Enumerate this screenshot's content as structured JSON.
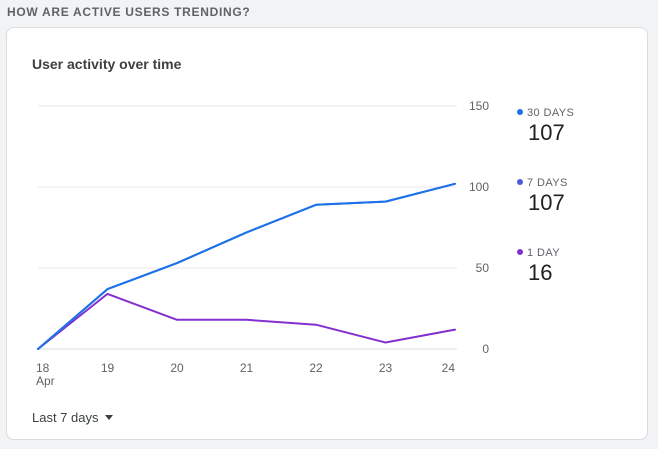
{
  "section_title": "HOW ARE ACTIVE USERS TRENDING?",
  "card": {
    "title": "User activity over time",
    "period_label": "Last 7 days",
    "period_icon": "dropdown-caret-icon"
  },
  "legend": [
    {
      "label": "30 DAYS",
      "value": "107",
      "color": "#1a73e8"
    },
    {
      "label": "7 DAYS",
      "value": "107",
      "color": "#4a5ad9"
    },
    {
      "label": "1 DAY",
      "value": "16",
      "color": "#8430ce"
    }
  ],
  "chart_data": {
    "type": "line",
    "x": [
      "18",
      "19",
      "20",
      "21",
      "22",
      "23",
      "24"
    ],
    "x_sublabel": "Apr",
    "ylim": [
      0,
      150
    ],
    "y_ticks": [
      0,
      50,
      100,
      150
    ],
    "y_axis_position": "right",
    "grid": true,
    "series": [
      {
        "name": "30 DAYS",
        "color": "#1a73e8",
        "values": [
          0,
          37,
          53,
          72,
          89,
          91,
          102
        ]
      },
      {
        "name": "7 DAYS",
        "color": "#4a5ad9",
        "values": [
          0,
          37,
          53,
          72,
          89,
          91,
          102
        ]
      },
      {
        "name": "1 DAY",
        "color": "#8430ce",
        "values": [
          0,
          34,
          18,
          18,
          15,
          4,
          12
        ]
      }
    ]
  }
}
